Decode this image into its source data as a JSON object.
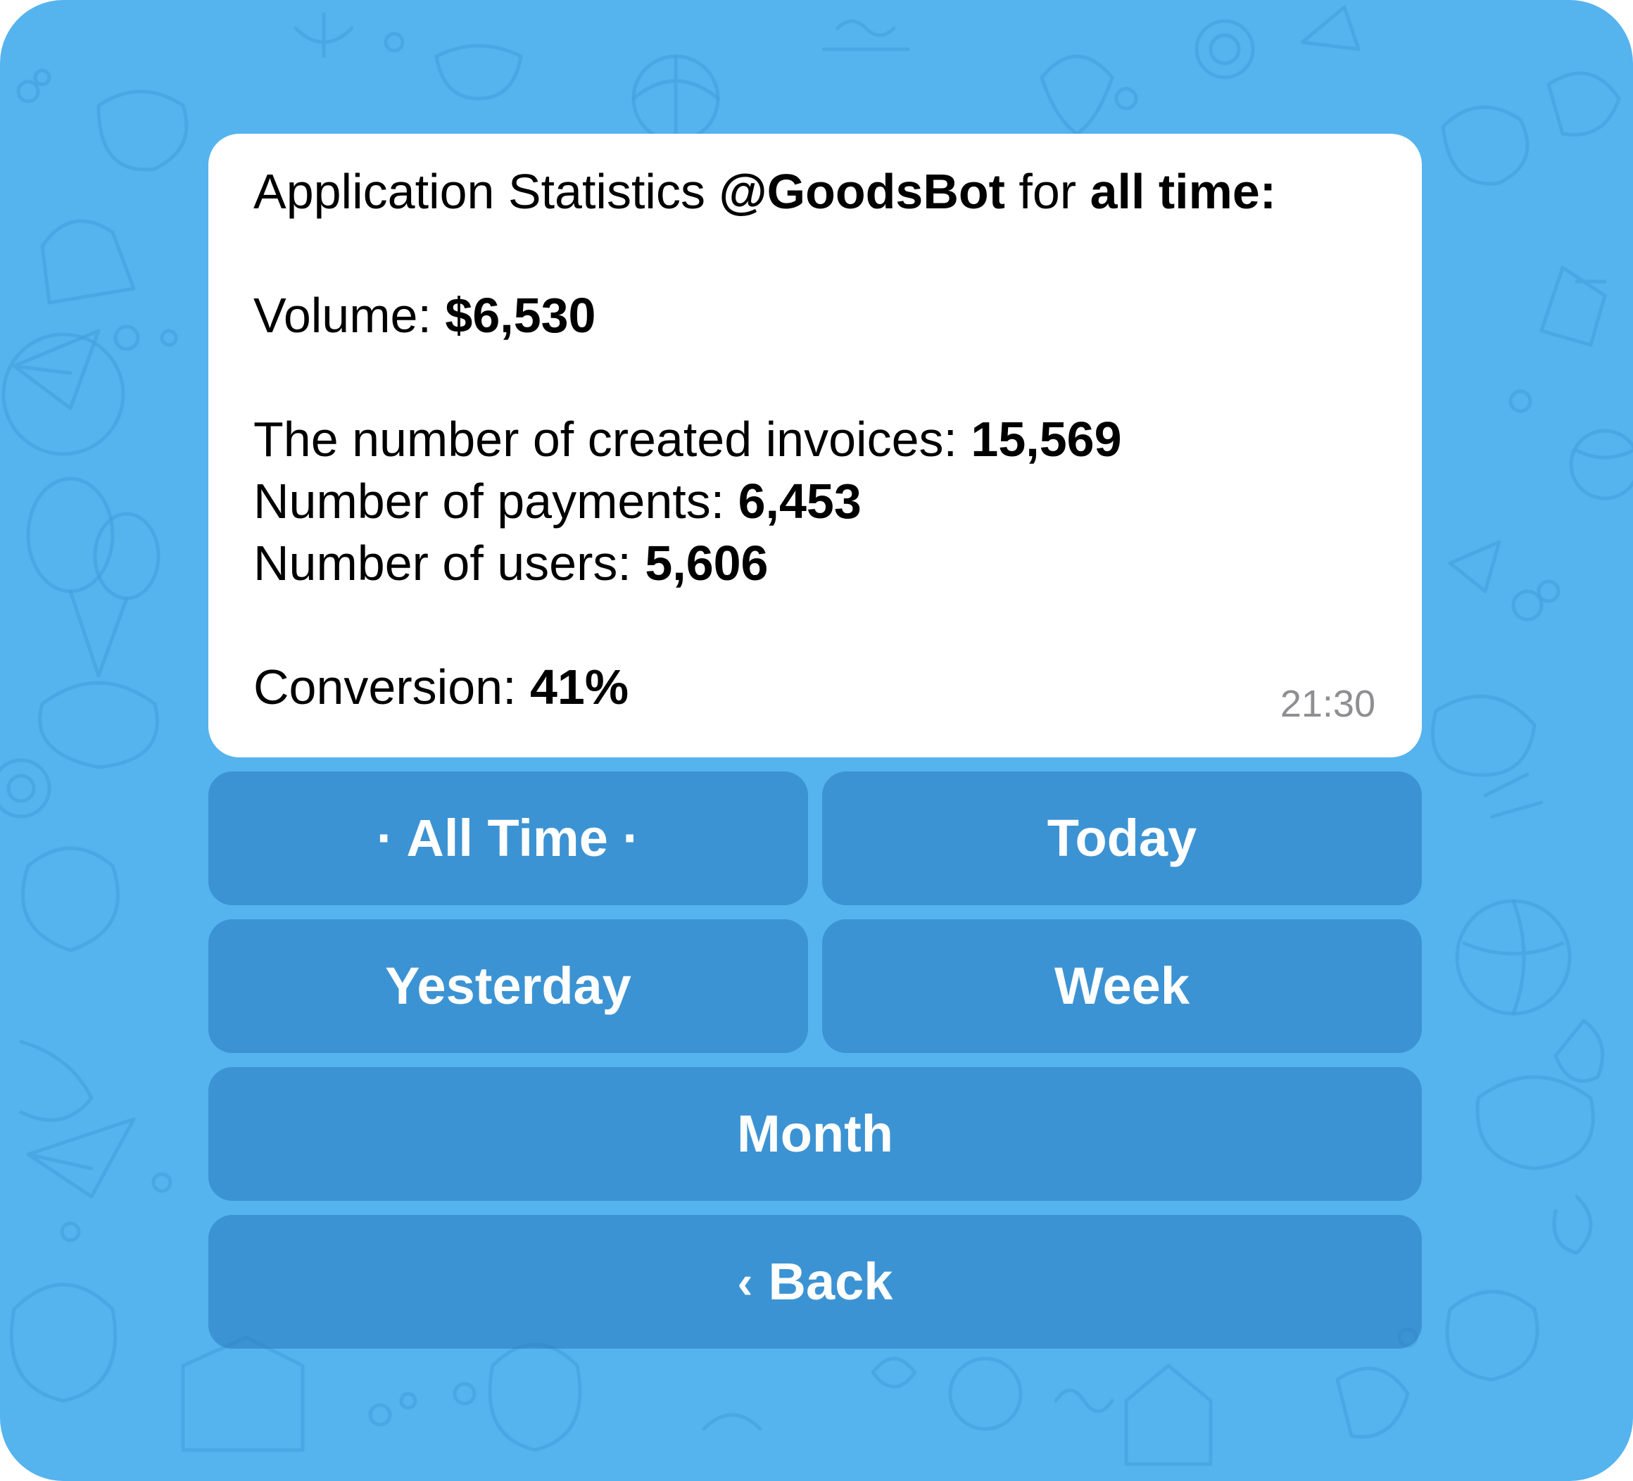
{
  "message": {
    "title_prefix": "Application Statistics ",
    "bot_handle": "@GoodsBot",
    "title_mid": " for ",
    "period": "all time:",
    "volume_label": "Volume: ",
    "volume_value": "$6,530",
    "invoices_label": "The number of created invoices: ",
    "invoices_value": "15,569",
    "payments_label": "Number of payments: ",
    "payments_value": "6,453",
    "users_label": "Number of users: ",
    "users_value": "5,606",
    "conversion_label": "Conversion: ",
    "conversion_value": "41%",
    "time": "21:30"
  },
  "keyboard": {
    "all_time": "· All Time ·",
    "today": "Today",
    "yesterday": "Yesterday",
    "week": "Week",
    "month": "Month",
    "back_icon": "‹",
    "back": "Back"
  },
  "colors": {
    "background": "#55b3ee",
    "bubble": "#ffffff",
    "button": "#3b8fcd",
    "button_text": "#ffffff",
    "time_text": "#8e8e93"
  }
}
